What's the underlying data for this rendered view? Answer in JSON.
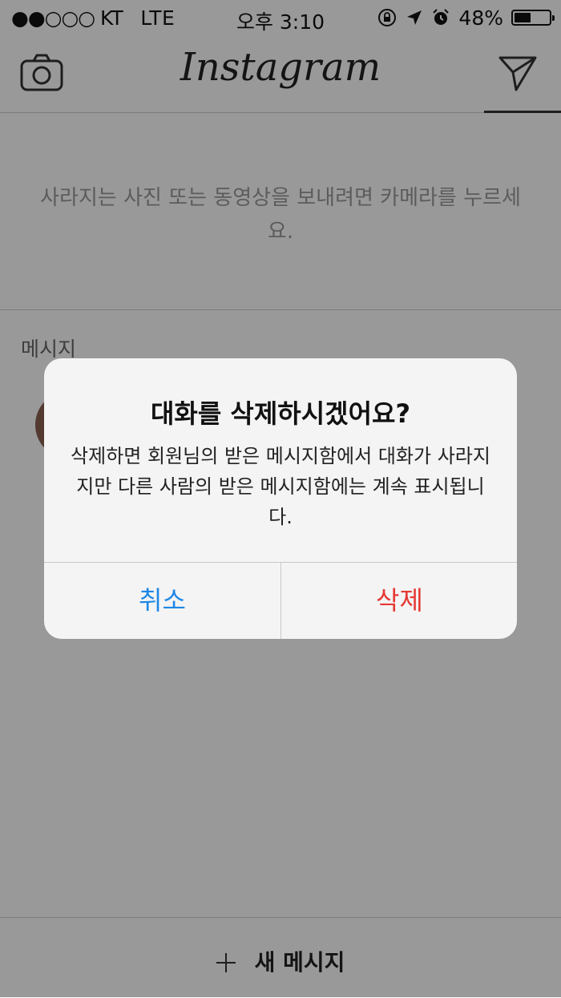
{
  "status_bar": {
    "carrier": "●●○○○ KT",
    "network": "LTE",
    "time": "오후 3:10",
    "battery": "48%",
    "battery_level": 0.48
  },
  "nav": {
    "title": "Instagram",
    "left_icon": "camera-icon",
    "right_icon": "send-icon"
  },
  "direct": {
    "empty_hint": "사라지는 사진 또는 동영상을 보내려면 카메라를 누르세요.",
    "section_label": "메시지"
  },
  "bottom": {
    "new_message": "새 메시지"
  },
  "alert": {
    "title": "대화를 삭제하시겠어요?",
    "message": "삭제하면 회원님의 받은 메시지함에서 대화가 사라지지만 다른 사람의 받은 메시지함에는 계속 표시됩니다.",
    "cancel": "취소",
    "delete": "삭제"
  },
  "colors": {
    "cancel": "#1e88e5",
    "destructive": "#e53935"
  }
}
